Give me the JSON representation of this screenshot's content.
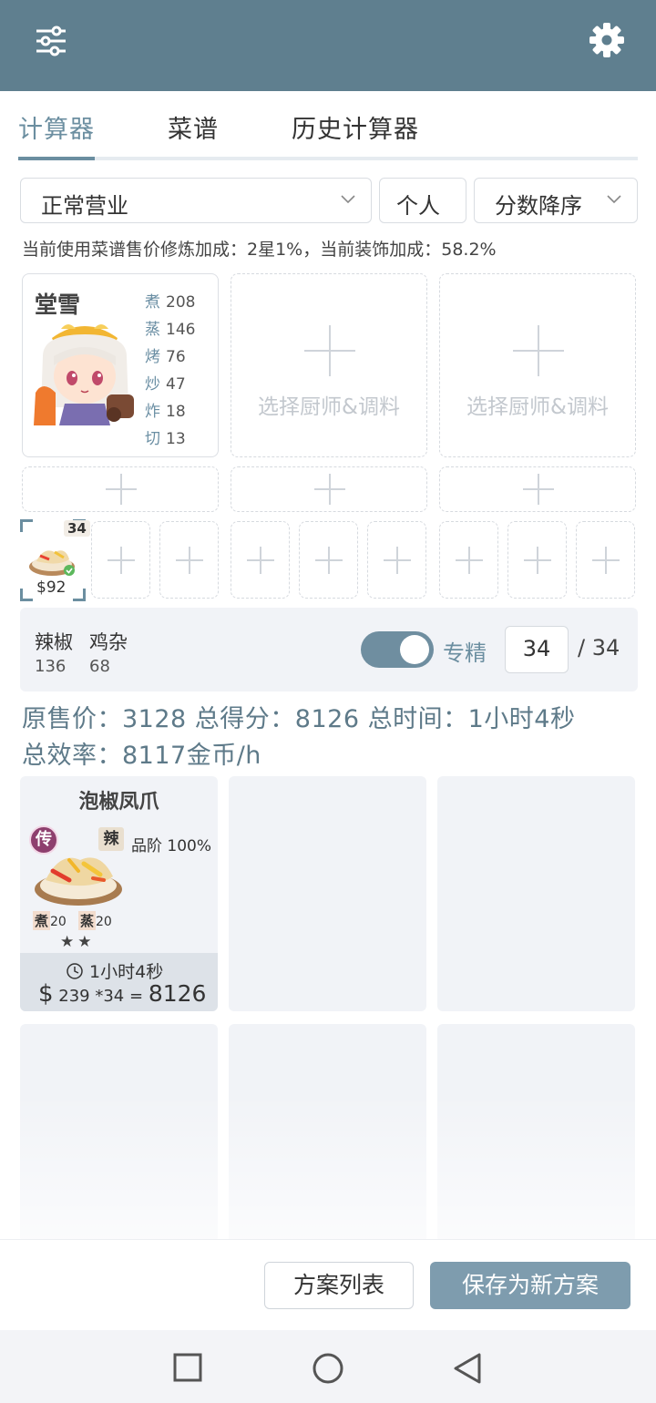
{
  "tabs": [
    {
      "label": "计算器",
      "active": true
    },
    {
      "label": "菜谱",
      "active": false
    },
    {
      "label": "历史计算器",
      "active": false
    }
  ],
  "filters": {
    "mode": "正常营业",
    "scope": "个人",
    "sort": "分数降序"
  },
  "info_line": "当前使用菜谱售价修炼加成：2星1%，当前装饰加成：58.2%",
  "chef": {
    "name": "堂雪",
    "skills": [
      {
        "key": "煮",
        "value": "208"
      },
      {
        "key": "蒸",
        "value": "146"
      },
      {
        "key": "烤",
        "value": "76"
      },
      {
        "key": "炒",
        "value": "47"
      },
      {
        "key": "炸",
        "value": "18"
      },
      {
        "key": "切",
        "value": "13"
      }
    ]
  },
  "empty_chef_slot_label": "选择厨师&调料",
  "selected_dish": {
    "count": "34",
    "price": "$92"
  },
  "ingredients": [
    {
      "name": "辣椒",
      "value": "136"
    },
    {
      "name": "鸡杂",
      "value": "68"
    }
  ],
  "specialize": {
    "label": "专精",
    "enabled": true,
    "quantity": "34",
    "max": "/ 34"
  },
  "summary": {
    "line1": "原售价：3128 总得分：8126 总时间：1小时4秒",
    "line2": "总效率：8117金币/h"
  },
  "recipe": {
    "name": "泡椒凤爪",
    "rank": "传",
    "tag": "辣",
    "quality": "品阶 100%",
    "skill1_key": "煮",
    "skill1_val": "20",
    "skill2_key": "蒸",
    "skill2_val": "20",
    "stars": "★★",
    "time": "1小时4秒",
    "dollar": "$",
    "calc": "239 *34 =",
    "score": "8126"
  },
  "buttons": {
    "plan_list": "方案列表",
    "save_new": "保存为新方案"
  },
  "colors": {
    "header": "#5f7f8f",
    "accent": "#6b8ea0",
    "primary_button": "#7e9cae"
  }
}
